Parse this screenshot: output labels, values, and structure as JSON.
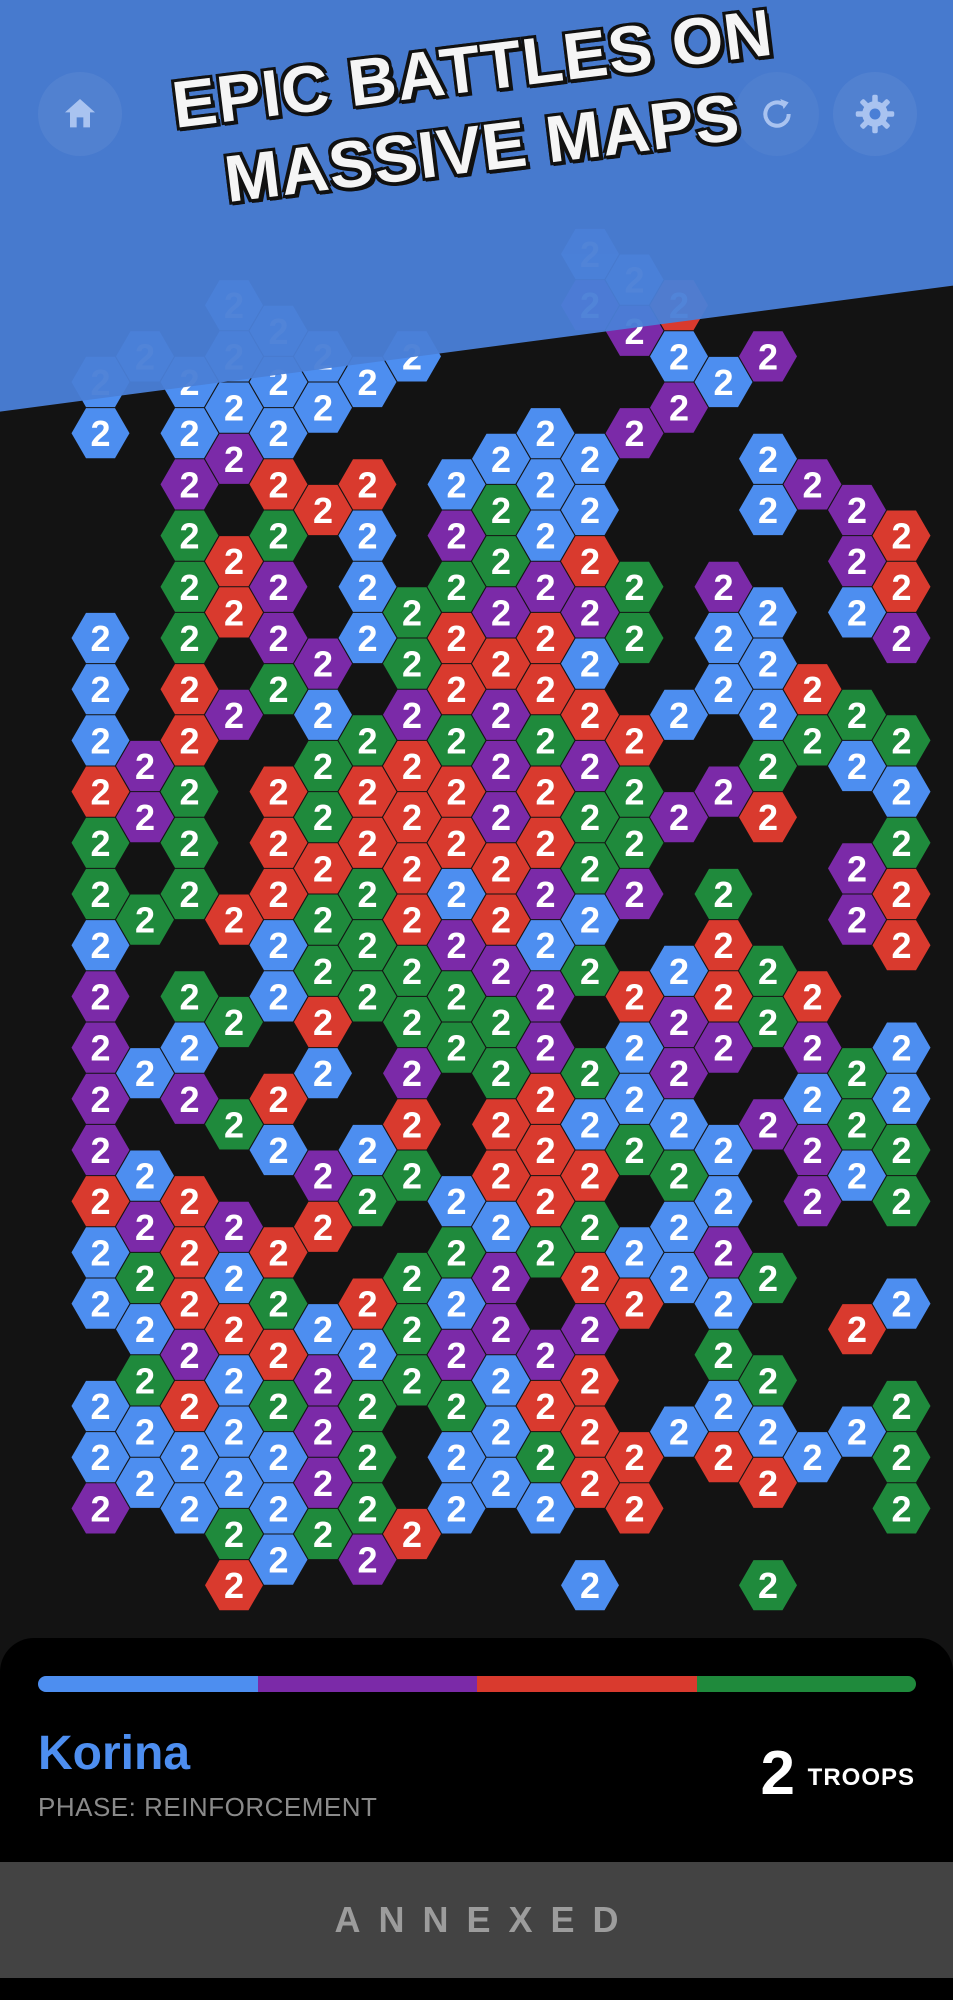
{
  "banner": {
    "line1": "EPIC BATTLES ON",
    "line2": "MASSIVE MAPS",
    "color": "#4a7fd6"
  },
  "toolbar": {
    "home_icon": "home-icon",
    "refresh_icon": "refresh-icon",
    "settings_icon": "gear-icon"
  },
  "colors": {
    "B": "#4d8ef0",
    "P": "#7b2aa8",
    "R": "#d93a2e",
    "G": "#1f8a3c",
    "background": "#131313"
  },
  "map": {
    "tile_label": "2",
    "rows": [
      "............BB.................",
      "....BB......PPR......BPPPG......",
      ".BBBBBBBB.....BBP...PP.P...P....",
      ".B.BBBB....B.PP.....BPPG........",
      "...PPR.R.BBBB...BP......PP......",
      "...G.GRB.PGBB...B.PR.RB.GPP.....",
      "...GRP.B.GGPRG.P..PRBPR.........",
      ".B.GRP.BGRPRPG.BB.BPBBRR.PR.....",
      ".B.R.GP.GRRRB..BBR..BPG.BB......",
      ".B.RP.BGPGPGRRB.BGGGBPPP.PRG....",
      ".RPG.RGRRRPRPG.PG.BBGPBGBG.R....",
      ".GPG.RGRRRPRGGP.R..GRGR.P.GB....",
      ".G.G.RRGRBRPGP.G..PRGBRR.R.R....",
      ".BG.RBGGRPRBB..R..PRBBRG.RRR....",
      ".P.G.BGGGGPPGRBRGR..GR.PRPG.....",
      ".P.BG.R.GGGP.BPPGP.BGBPPGP......",
      ".PBP.RB.P.GRGBP..BGBBGPBBBB.....",
      ".P..GB.BR.RRBGBBPPGGRPBR.RR.....",
      ".RBR..PGGBRRR.GB.PBGBRG..R......",
      ".BPRPRR..GBGGBBP....GBG..G......",
      ".BGRBG.RGBP.RRBBG..BBGGG.GG.....",
      "..BPRRBBGPPPP..G..R.PGPPR.P.....",
      ".BGRBGPGGGBRR..BG..GRGGPG.......",
      ".BBBBBPG.BBGRRBRBBBG.BBB.BB.....",
      ".PBBBBPG.BBBRR..R..G..GR.......",
      "....GBGPR.......................",
      "....R.......BB.PGP.R......G.....",
      "....RPPPGGRPPPPP.PGPG.G.........",
      ".....PRPG.GP......PG.BBPBBGGG...",
      "......GBPG..BB.BGBBG.BGPBB......",
      "......B..B.....BG.B.GBBBB.......",
      "..............BGGGBG.B.........."
    ]
  },
  "status": {
    "player_name": "Korina",
    "player_color": "#4d8ef0",
    "phase_text": "PHASE: REINFORCEMENT",
    "troops_count": "2",
    "troops_label": "TROOPS",
    "share": [
      {
        "name": "blue",
        "color": "#4d8ef0",
        "fraction": 0.25
      },
      {
        "name": "purple",
        "color": "#7b2aa8",
        "fraction": 0.25
      },
      {
        "name": "red",
        "color": "#d93a2e",
        "fraction": 0.25
      },
      {
        "name": "green",
        "color": "#1f8a3c",
        "fraction": 0.25
      }
    ]
  },
  "action": {
    "label": "ANNEXED"
  }
}
